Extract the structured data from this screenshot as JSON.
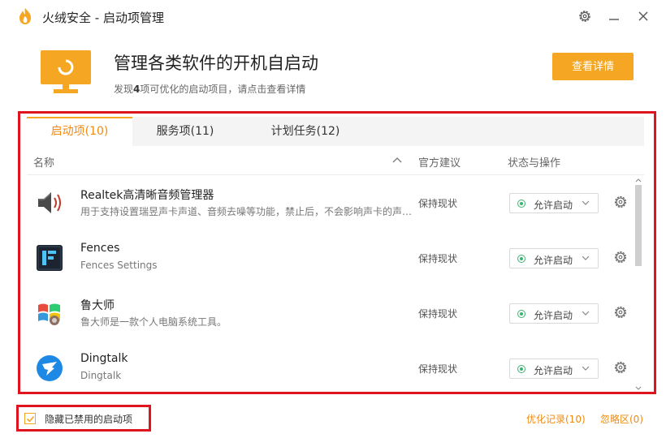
{
  "window": {
    "title": "火绒安全 - 启动项管理"
  },
  "header": {
    "headline": "管理各类软件的开机自启动",
    "sub_prefix": "发现",
    "sub_count": "4",
    "sub_suffix": "项可优化的启动项目，请点击查看详情",
    "detail_button": "查看详情"
  },
  "tabs": [
    {
      "label": "启动项(10)",
      "active": true
    },
    {
      "label": "服务项(11)",
      "active": false
    },
    {
      "label": "计划任务(12)",
      "active": false
    }
  ],
  "columns": {
    "name": "名称",
    "advice": "官方建议",
    "status": "状态与操作"
  },
  "rows": [
    {
      "name": "Realtek高清晰音频管理器",
      "desc": "用于支持设置瑞昱声卡声道、音频去噪等功能，禁止后，不会影响声卡的声音输出",
      "advice": "保持现状",
      "status": "允许启动",
      "icon": "speaker-icon"
    },
    {
      "name": "Fences",
      "desc": "Fences Settings",
      "advice": "保持现状",
      "status": "允许启动",
      "icon": "fences-icon"
    },
    {
      "name": "鲁大师",
      "desc": "鲁大师是一款个人电脑系统工具。",
      "advice": "保持现状",
      "status": "允许启动",
      "icon": "ludashi-icon"
    },
    {
      "name": "Dingtalk",
      "desc": "Dingtalk",
      "advice": "保持现状",
      "status": "允许启动",
      "icon": "dingtalk-icon"
    }
  ],
  "footer": {
    "hide_disabled_label": "隐藏已禁用的启动项",
    "hide_disabled_checked": true,
    "history_link": "优化记录(10)",
    "ignore_link": "忽略区(0)"
  },
  "colors": {
    "accent": "#f5a623",
    "accent_text": "#f08a12",
    "highlight_border": "#e0141e",
    "status_green": "#3cb371"
  }
}
